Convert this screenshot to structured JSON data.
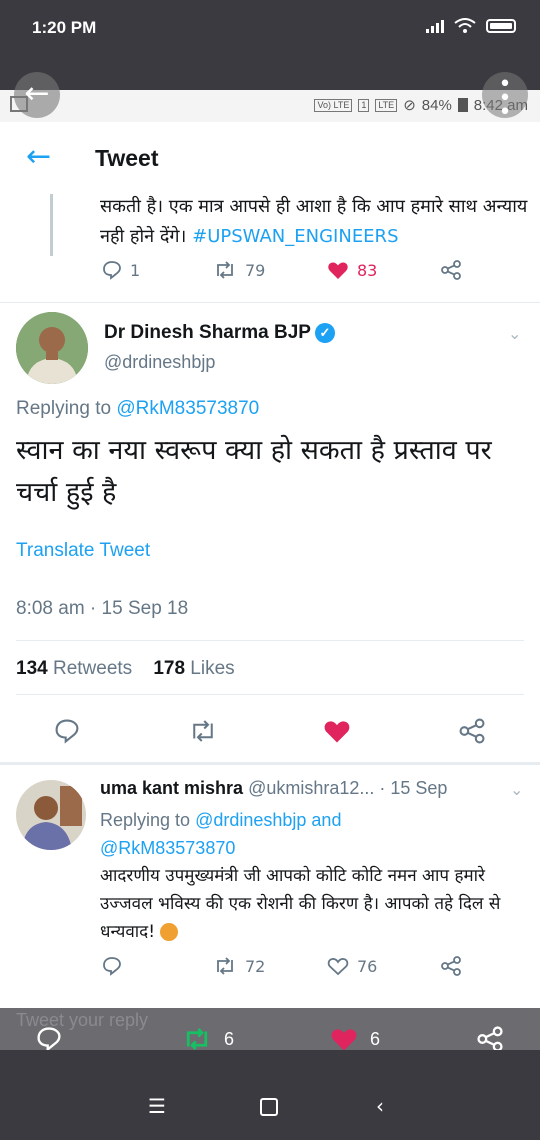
{
  "outer_status": {
    "time": "1:20 PM"
  },
  "inner_status": {
    "network": "Vo) LTE",
    "sim": "1",
    "lte": "LTE",
    "battery": "84%",
    "time": "8:42 am"
  },
  "header": {
    "title": "Tweet"
  },
  "previous_tweet": {
    "text": "सकती है। एक मात्र आपसे ही आशा है कि आप हमारे साथ अन्याय नही होने देंगे।",
    "hashtag": "#UPSWAN_ENGINEERS",
    "replies": "1",
    "retweets": "79",
    "likes": "83"
  },
  "main_tweet": {
    "name": "Dr Dinesh Sharma BJP",
    "handle": "@drdineshbjp",
    "replying_prefix": "Replying to",
    "replying_to": "@RkM83573870",
    "text": "स्वान का नया स्वरूप क्या हो सकता है प्रस्ताव पर चर्चा हुई है",
    "translate": "Translate Tweet",
    "timestamp": "8:08 am · 15 Sep 18",
    "retweet_count": "134",
    "retweet_label": "Retweets",
    "like_count": "178",
    "like_label": "Likes"
  },
  "reply_tweet": {
    "name": "uma kant mishra",
    "handle_date": "@ukmishra12... · 15 Sep",
    "replying_prefix": "Replying to",
    "replying_to": "@drdineshbjp and @RkM83573870",
    "text": "आदरणीय उपमुख्यमंत्री जी आपको कोटि कोटि नमन आप हमारे उज्जवल भविस्य की एक रोशनी की किरण है। आपको तहे दिल से धन्यवाद!",
    "retweets": "72",
    "likes": "76"
  },
  "compose": {
    "placeholder": "Tweet your reply"
  },
  "overlay_actions": {
    "retweets": "6",
    "likes": "6"
  },
  "colors": {
    "accent": "#1da1f2",
    "like": "#e0245e",
    "retweet_green": "#17bf63"
  }
}
